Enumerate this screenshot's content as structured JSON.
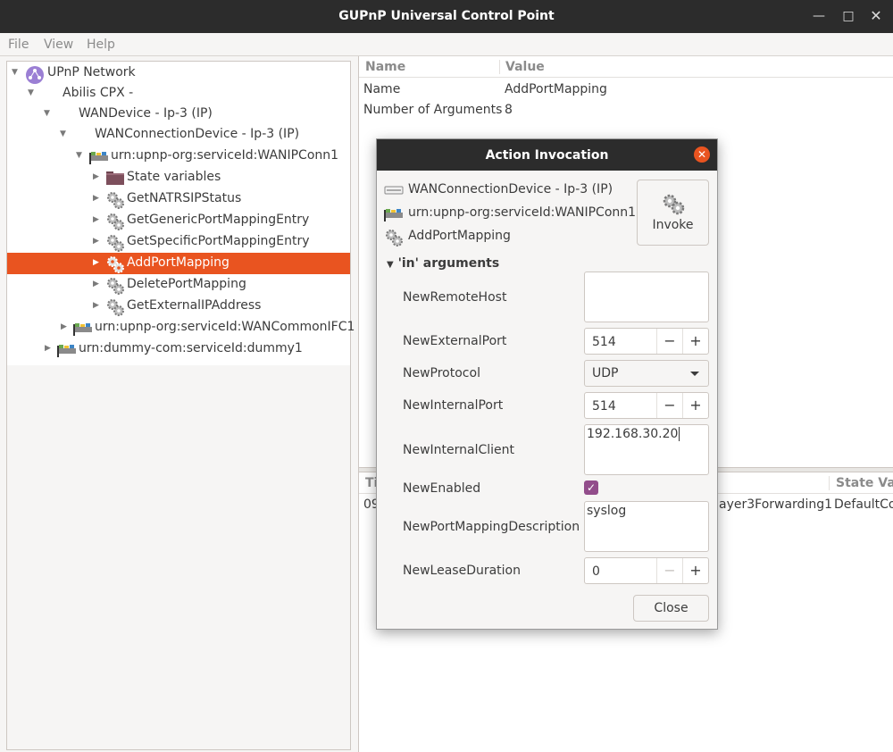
{
  "window": {
    "title": "GUPnP Universal Control Point"
  },
  "menu": [
    "File",
    "View",
    "Help"
  ],
  "tree": [
    {
      "label": "UPnP Network",
      "icon": "network-icon"
    },
    {
      "label": "Abilis CPX -",
      "icon": ""
    },
    {
      "label": "WANDevice - Ip-3 (IP)",
      "icon": ""
    },
    {
      "label": "WANConnectionDevice - Ip-3 (IP)",
      "icon": ""
    },
    {
      "label": "urn:upnp-org:serviceId:WANIPConn1",
      "icon": "service-icon"
    },
    {
      "label": "State variables",
      "icon": "folder-icon"
    },
    {
      "label": "GetNATRSIPStatus",
      "icon": "action-gears-icon"
    },
    {
      "label": "GetGenericPortMappingEntry",
      "icon": "action-gears-icon"
    },
    {
      "label": "GetSpecificPortMappingEntry",
      "icon": "action-gears-icon"
    },
    {
      "label": "AddPortMapping",
      "icon": "action-gears-icon"
    },
    {
      "label": "DeletePortMapping",
      "icon": "action-gears-icon"
    },
    {
      "label": "GetExternalIPAddress",
      "icon": "action-gears-icon"
    },
    {
      "label": "urn:upnp-org:serviceId:WANCommonIFC1",
      "icon": "service-icon"
    },
    {
      "label": "urn:dummy-com:serviceId:dummy1",
      "icon": "service-icon"
    }
  ],
  "details": {
    "headers": {
      "name": "Name",
      "value": "Value"
    },
    "rows": [
      {
        "name": "Name",
        "value": "AddPortMapping"
      },
      {
        "name": "Number of Arguments",
        "value": "8"
      }
    ]
  },
  "events": {
    "col_left": "Ti",
    "col_right": "State Var",
    "row_left": "09",
    "row_mid": "ayer3Forwarding1",
    "row_right": "DefaultCo"
  },
  "dialog": {
    "title": "Action Invocation",
    "device": "WANConnectionDevice - Ip-3 (IP)",
    "service": "urn:upnp-org:serviceId:WANIPConn1",
    "action": "AddPortMapping",
    "invoke_label": "Invoke",
    "section": "'in' arguments",
    "args": {
      "remote_host": {
        "label": "NewRemoteHost",
        "value": ""
      },
      "external_port": {
        "label": "NewExternalPort",
        "value": "514"
      },
      "protocol": {
        "label": "NewProtocol",
        "value": "UDP"
      },
      "internal_port": {
        "label": "NewInternalPort",
        "value": "514"
      },
      "internal_client": {
        "label": "NewInternalClient",
        "value": "192.168.30.20"
      },
      "enabled": {
        "label": "NewEnabled",
        "value": "checked"
      },
      "description": {
        "label": "NewPortMappingDescription",
        "value": "syslog"
      },
      "lease": {
        "label": "NewLeaseDuration",
        "value": "0"
      }
    },
    "close_label": "Close"
  },
  "colors": {
    "accent": "#e95420",
    "checkbox": "#924d8b",
    "titlebar": "#2c2c2c"
  }
}
